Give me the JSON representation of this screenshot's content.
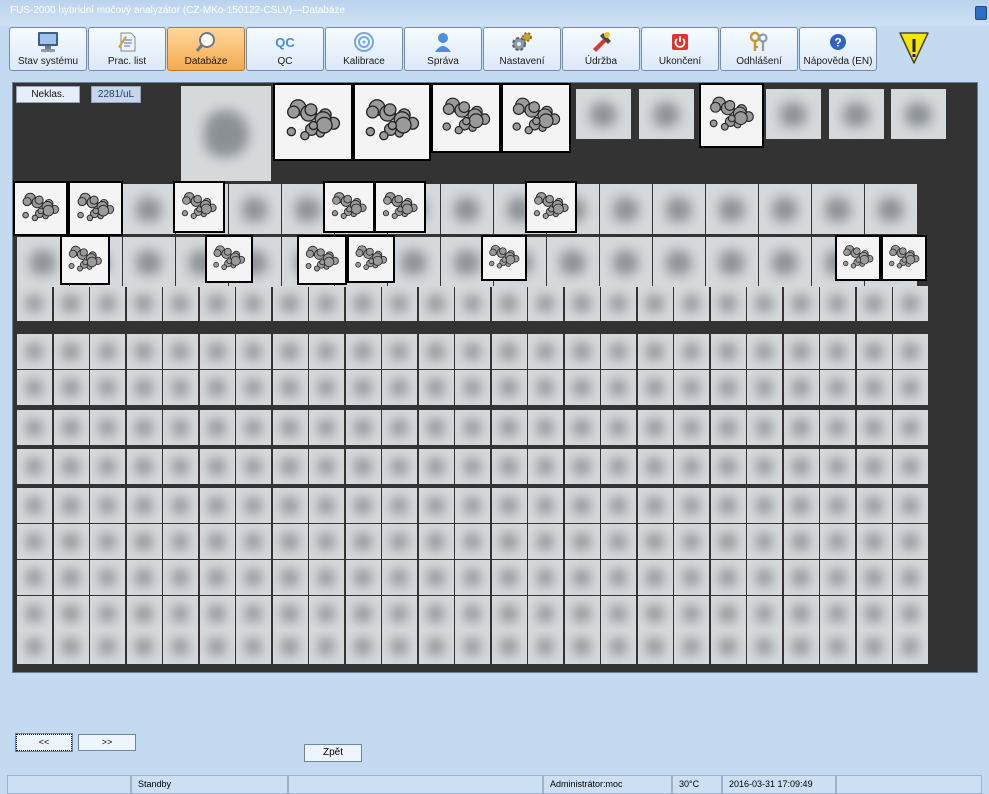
{
  "window": {
    "title": "FUS-2000 hybridní močový analyzátor (CZ-MKo-150122-CSLV)—Databáze"
  },
  "toolbar": {
    "buttons": [
      {
        "label": "Stav systému",
        "icon": "monitor-icon"
      },
      {
        "label": "Prac. list",
        "icon": "worksheet-icon"
      },
      {
        "label": "Databáze",
        "icon": "magnifier-icon",
        "active": true
      },
      {
        "label": "QC",
        "icon": "qc-icon",
        "icon_text": "QC"
      },
      {
        "label": "Kalibrace",
        "icon": "target-icon"
      },
      {
        "label": "Správa",
        "icon": "user-icon"
      },
      {
        "label": "Nastavení",
        "icon": "gears-icon"
      },
      {
        "label": "Údržba",
        "icon": "maintenance-icon"
      },
      {
        "label": "Ukončení",
        "icon": "power-icon"
      },
      {
        "label": "Odhlášení",
        "icon": "keys-icon"
      },
      {
        "label": "Nápověda (EN)",
        "icon": "help-icon"
      }
    ]
  },
  "image_panel": {
    "class_label": "Neklas.",
    "count_label": "2281/uL"
  },
  "nav": {
    "prev_label": "<<",
    "next_label": ">>",
    "back_label": "Zpět"
  },
  "statusbar": {
    "cells": [
      "",
      "Standby",
      "",
      "Administrátor:moc",
      "30°C",
      "2016-03-31 17:09:49",
      ""
    ]
  },
  "colors": {
    "background": "#c4daf1",
    "active_button": "#f5a94d",
    "panel": "#333333",
    "warning": "#f5e600"
  }
}
